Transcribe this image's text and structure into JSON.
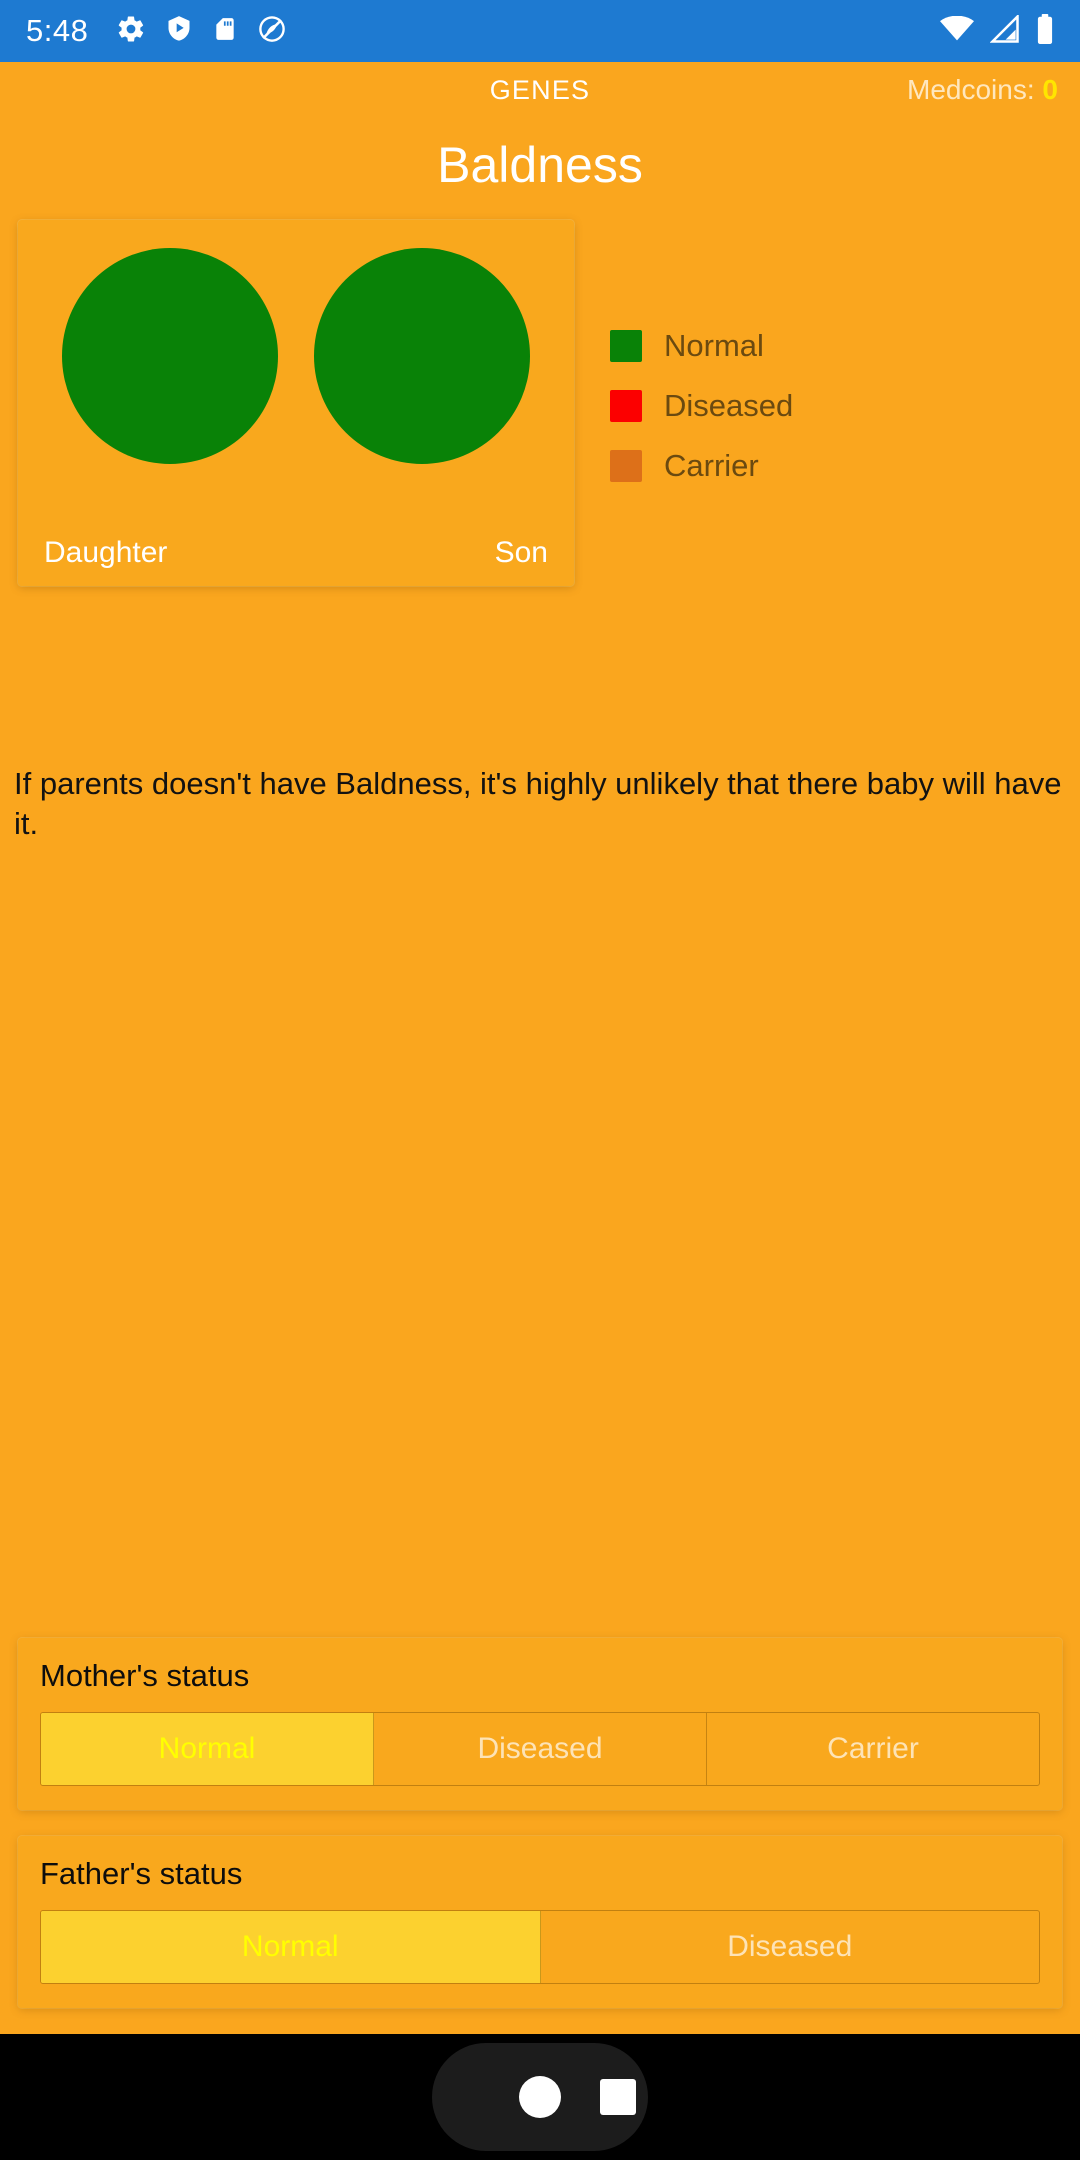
{
  "status_bar": {
    "time": "5:48",
    "left_icons": [
      "gear-icon",
      "play-shield-icon",
      "sd-card-icon",
      "circle-logo-icon"
    ],
    "right_icons": [
      "wifi-icon",
      "cellular-signal-icon",
      "battery-icon"
    ]
  },
  "app_bar": {
    "title": "GENES",
    "medcoins_label": "Medcoins: ",
    "medcoins_value": "0"
  },
  "page": {
    "title": "Baldness",
    "description": "If parents doesn't have Baldness, it's highly unlikely that there baby will have it."
  },
  "children": [
    {
      "label": "Daughter",
      "status": "Normal",
      "color": "#098207"
    },
    {
      "label": "Son",
      "status": "Normal",
      "color": "#098207"
    }
  ],
  "legend": [
    {
      "label": "Normal",
      "color": "#098207"
    },
    {
      "label": "Diseased",
      "color": "#FC0000"
    },
    {
      "label": "Carrier",
      "color": "#DD7019"
    }
  ],
  "mother": {
    "title": "Mother's status",
    "options": [
      "Normal",
      "Diseased",
      "Carrier"
    ],
    "selected": "Normal"
  },
  "father": {
    "title": "Father's status",
    "options": [
      "Normal",
      "Diseased"
    ],
    "selected": "Normal"
  },
  "nav_bar": {
    "home_label": "home-button",
    "recents_label": "recents-button"
  },
  "theme": {
    "background": "#FAA61E",
    "status_bar": "#1E7AD1",
    "selected_segment": "#FCD12F",
    "selected_text": "#FFFF00"
  }
}
